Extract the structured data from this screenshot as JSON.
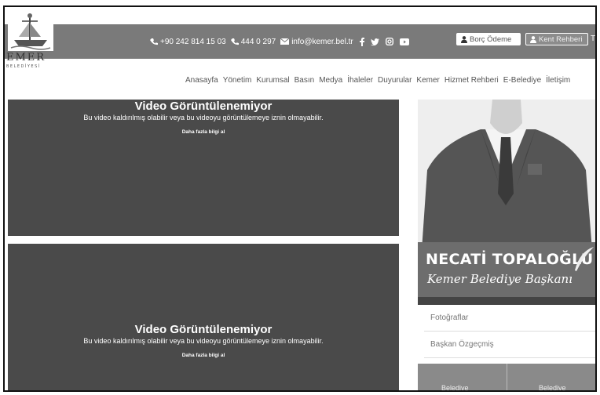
{
  "logo": {
    "wordmark": "EMER",
    "sub": "BELEDİYESİ"
  },
  "topbar": {
    "phone1": "+90 242 814 15 03",
    "phone2": "444 0 297",
    "email": "info@kemer.bel.tr",
    "borc_label": "Borç Ödeme",
    "rehber_label": "Kent Rehberi",
    "overflow_char": "T"
  },
  "nav": [
    "Anasayfa",
    "Yönetim",
    "Kurumsal",
    "Basın",
    "Medya",
    "İhaleler",
    "Duyurular",
    "Kemer",
    "Hizmet Rehberi",
    "E-Belediye",
    "İletişim"
  ],
  "videos": [
    {
      "title": "Video Görüntülenemiyor",
      "desc": "Bu video kaldırılmış olabilir veya bu videoyu görüntülemeye iznin olmayabilir.",
      "link": "Daha fazla bilgi al"
    },
    {
      "title": "Video Görüntülenemiyor",
      "desc": "Bu video kaldırılmış olabilir veya bu videoyu görüntülemeye iznin olmayabilir.",
      "link": "Daha fazla bilgi al"
    }
  ],
  "mayor": {
    "name": "NECATİ TOPALOĞLU",
    "title": "Kemer Belediye Başkanı"
  },
  "sidemenu": [
    "Fotoğraflar",
    "Başkan Özgeçmiş"
  ],
  "tiles": [
    "Belediye",
    "Belediye"
  ]
}
